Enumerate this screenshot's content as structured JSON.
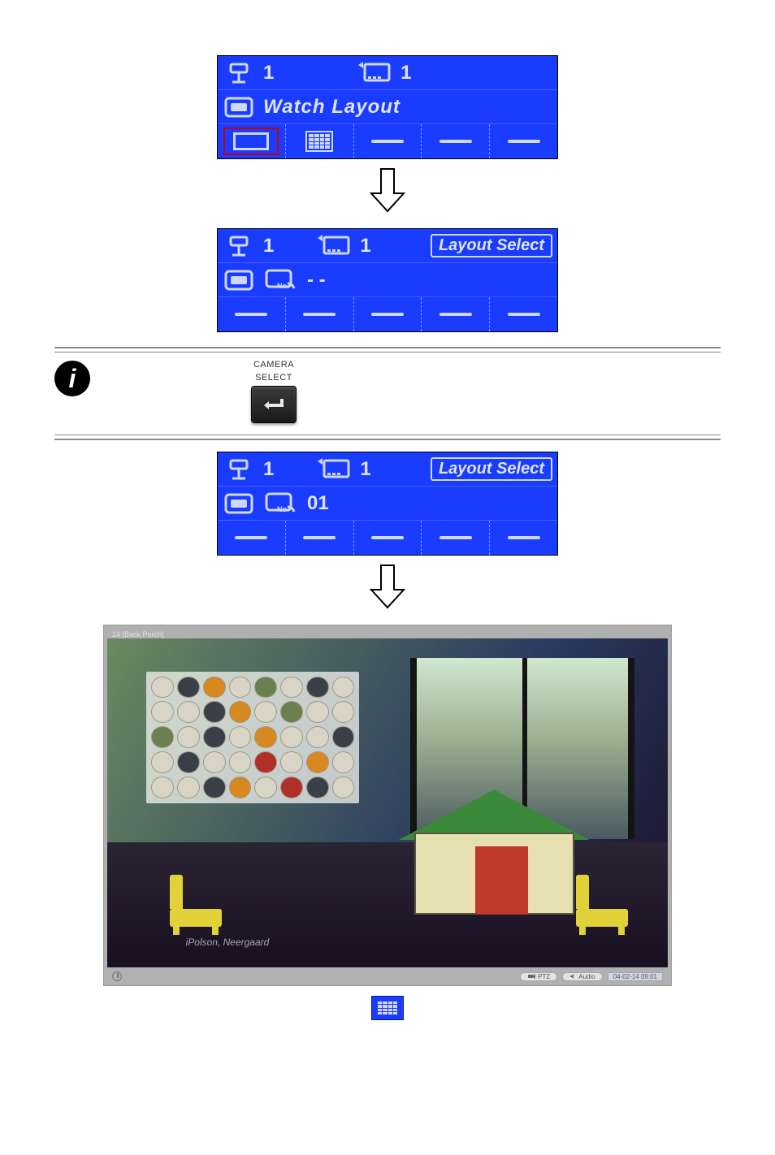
{
  "panel1": {
    "camera_no": "1",
    "monitor_no": "1",
    "title": "Watch Layout"
  },
  "panel2": {
    "camera_no": "1",
    "monitor_no": "1",
    "button": "Layout Select",
    "layout_no": "- -"
  },
  "camBtn": {
    "line1": "CAMERA",
    "line2": "SELECT"
  },
  "panel3": {
    "camera_no": "1",
    "monitor_no": "1",
    "button": "Layout Select",
    "layout_no": "01"
  },
  "screenshot": {
    "title": "24 [Back Porch]",
    "watermark": "iPolson, Neergaard",
    "ptz": "PTZ",
    "audio": "Audio",
    "datetime": "04-02-14 09:01"
  }
}
